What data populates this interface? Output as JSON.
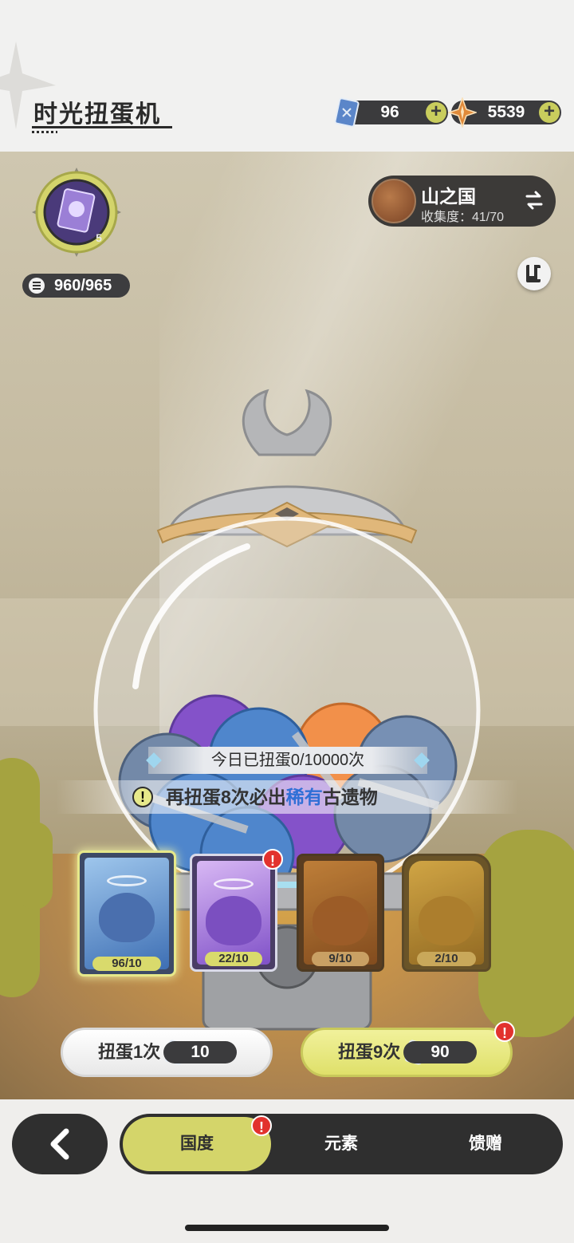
{
  "header": {
    "title": "时光扭蛋机",
    "currencies": [
      {
        "icon": "ticket-icon",
        "value": "96"
      },
      {
        "icon": "star-crystal-icon",
        "value": "5539"
      }
    ],
    "plus_label": "+"
  },
  "scene": {
    "ticket_badge_level": "5",
    "ticket_count": "960/965",
    "region": {
      "name": "山之国",
      "progress": "收集度：41/70"
    },
    "today_count": "今日已扭蛋0/10000次",
    "pity": {
      "prefix": "再扭蛋8次必出",
      "highlight": "稀有",
      "suffix": "古遗物",
      "icon_label": "!"
    },
    "cards": [
      {
        "count": "96/10",
        "color": "blue",
        "alert": false
      },
      {
        "count": "22/10",
        "color": "purple",
        "alert": true
      },
      {
        "count": "9/10",
        "color": "orange",
        "alert": false
      },
      {
        "count": "2/10",
        "color": "gold",
        "alert": false
      }
    ],
    "alert_label": "!",
    "spin_buttons": [
      {
        "label": "扭蛋1次",
        "cost": "10",
        "alert": false
      },
      {
        "label": "扭蛋9次",
        "cost": "90",
        "alert": true
      }
    ]
  },
  "nav": {
    "back_icon": "chevron-left-icon",
    "tabs": [
      {
        "label": "国度",
        "active": true,
        "alert": true
      },
      {
        "label": "元素",
        "active": false,
        "alert": false
      },
      {
        "label": "馈赠",
        "active": false,
        "alert": false
      }
    ]
  },
  "colors": {
    "accent": "#d4d56a",
    "dark": "#2f2f2f",
    "highlight": "#2f6fd6",
    "alert": "#e2322e"
  }
}
